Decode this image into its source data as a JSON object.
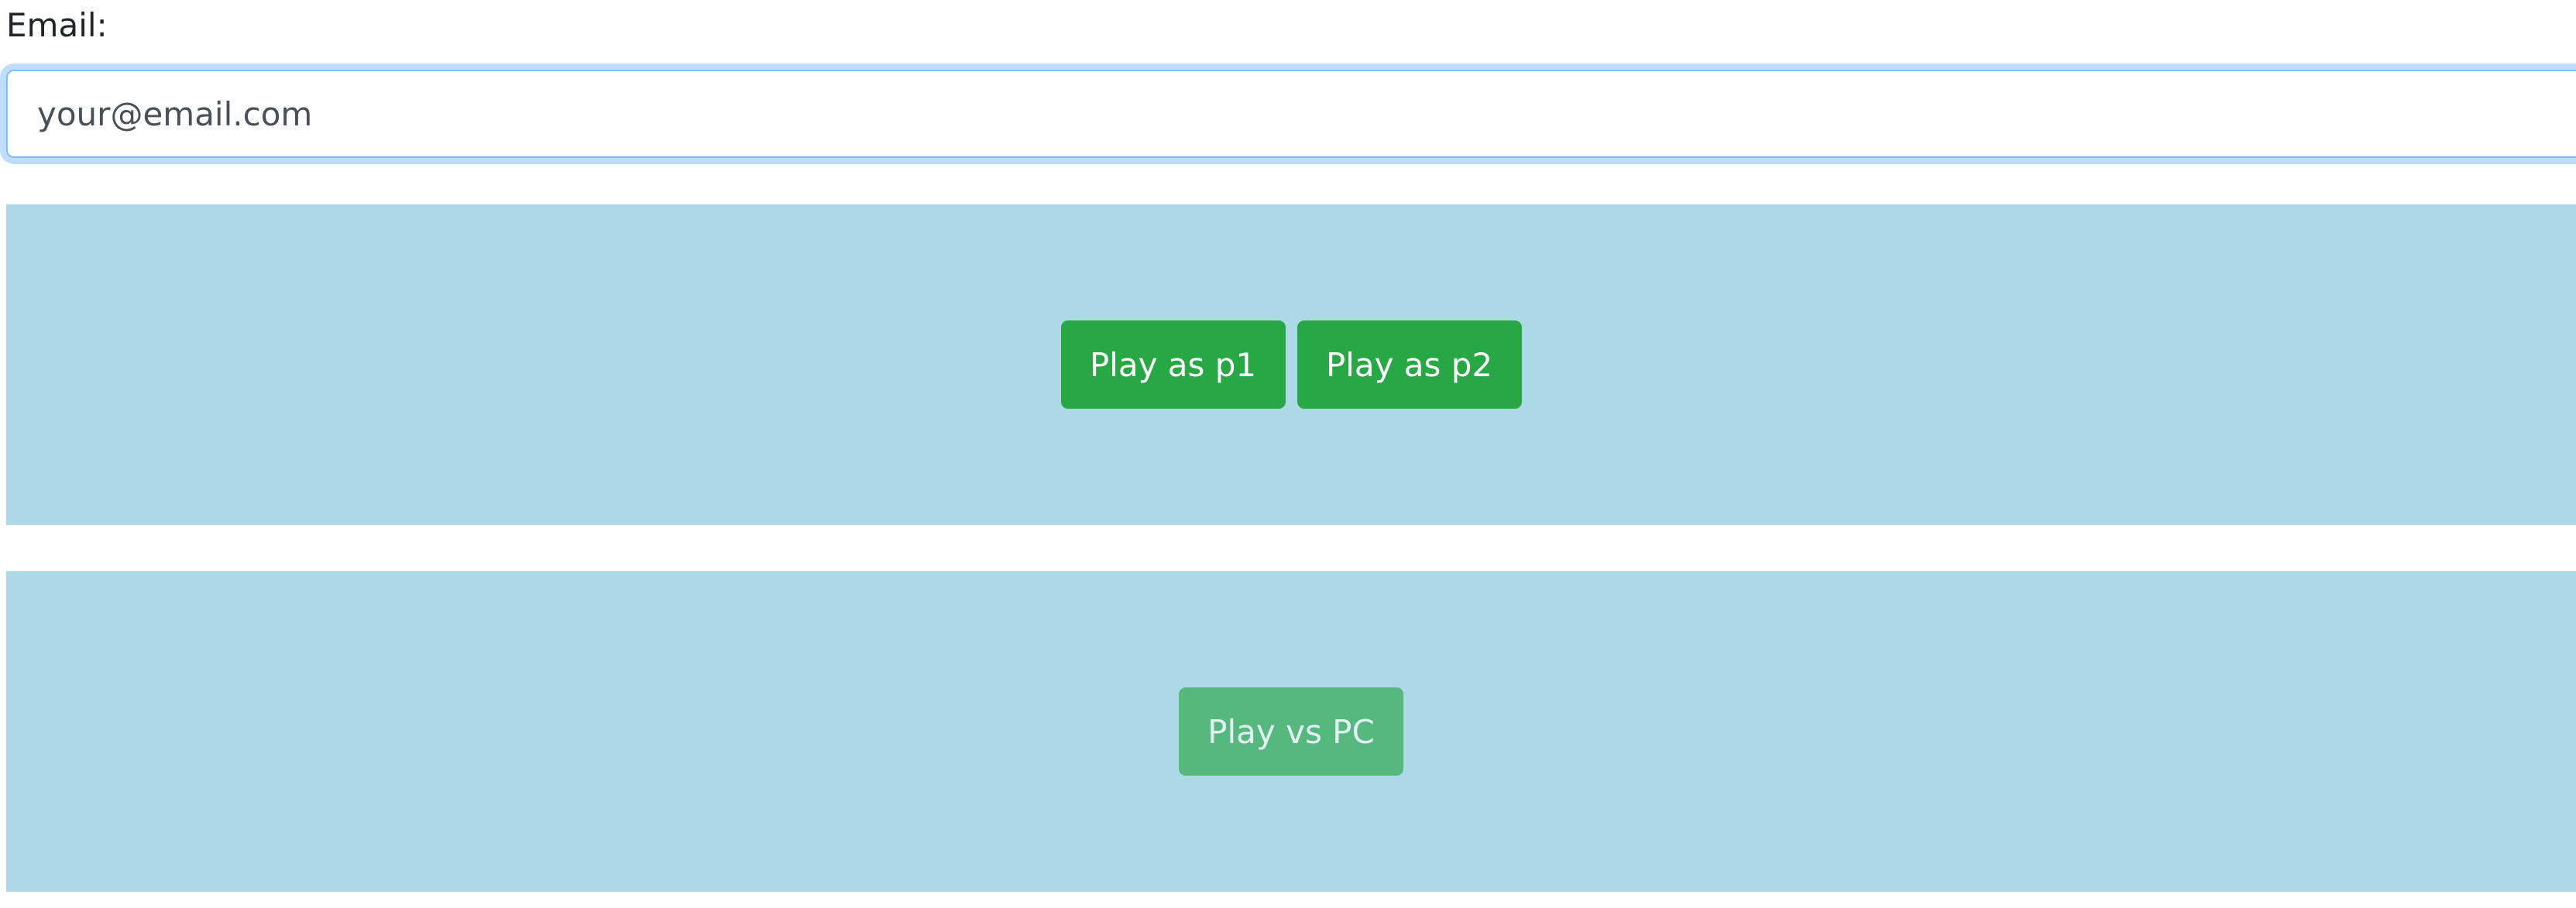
{
  "form": {
    "email_label": "Email:",
    "email_placeholder": "your@email.com",
    "email_value": ""
  },
  "multiplayer": {
    "play_p1_label": "Play as p1",
    "play_p2_label": "Play as p2"
  },
  "single_player": {
    "play_pc_label": "Play vs PC",
    "play_pc_disabled": true
  },
  "colors": {
    "panel_background": "#add8e6",
    "button_success": "#28a745",
    "input_focus_border": "#80bdff"
  }
}
